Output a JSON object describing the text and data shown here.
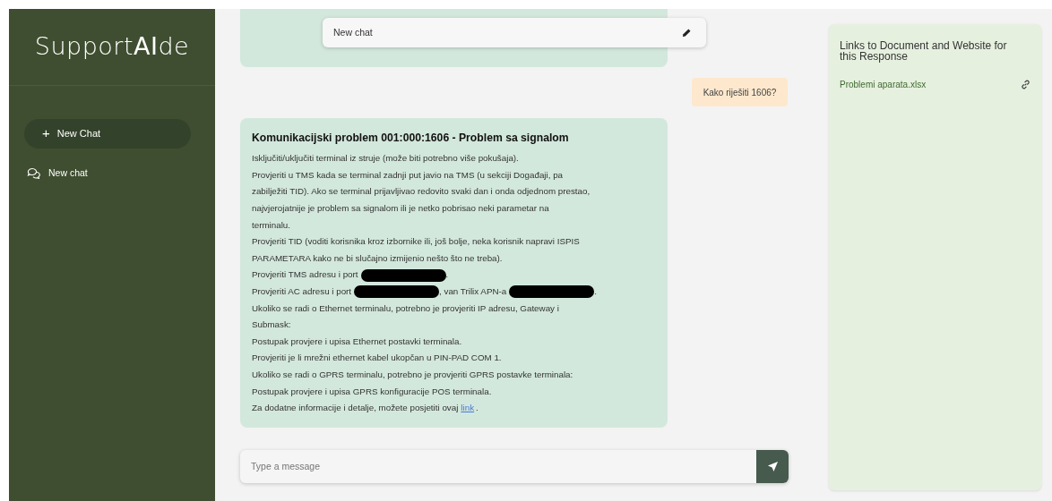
{
  "sidebar": {
    "logo": "Support**AI**de",
    "new_chat_button": {
      "icon": "+",
      "label": "New Chat"
    },
    "items": [
      {
        "label": "New chat",
        "selected": false
      }
    ]
  },
  "header": {
    "title": "New chat"
  },
  "messages": [
    {
      "kind": "cut"
    },
    {
      "kind": "user",
      "text": "Kako riješiti 1606?"
    },
    {
      "kind": "bot",
      "title": "Komunikacijski problem 001:000:1606 - Problem sa signalom",
      "lines": [
        [
          {
            "kind": "text",
            "text": "Isključiti/uključiti terminal iz struje (može biti potrebno više pokušaja)."
          }
        ],
        [
          {
            "kind": "text",
            "text": "Provjeriti u TMS kada se terminal zadnji put javio na TMS (u sekciji Događaji, pa"
          }
        ],
        [
          {
            "kind": "text",
            "text": "zabilježiti TID). Ako se terminal prijavljivao redovito svaki dan i onda odjednom prestao,"
          }
        ],
        [
          {
            "kind": "text",
            "text": "najvjerojatnije je problem sa signalom ili je netko pobrisao neki parametar na"
          }
        ],
        [
          {
            "kind": "text",
            "text": "terminalu."
          }
        ],
        [
          {
            "kind": "text",
            "text": "Provjeriti TID (voditi korisnika kroz izbornike ili, još bolje, neka korisnik napravi ISPIS"
          }
        ],
        [
          {
            "kind": "text",
            "text": "PARAMETARA kako ne bi slučajno izmijenio nešto što ne treba)."
          }
        ],
        [
          {
            "kind": "text",
            "text": "Provjeriti TMS adresu i port"
          },
          {
            "kind": "redacted"
          },
          {
            "kind": "text",
            "text": "."
          }
        ],
        [
          {
            "kind": "text",
            "text": "Provjeriti AC adresu i port"
          },
          {
            "kind": "redacted"
          },
          {
            "kind": "text",
            "text": ", van Trilix APN-a"
          },
          {
            "kind": "redacted"
          },
          {
            "kind": "text",
            "text": "."
          }
        ],
        [
          {
            "kind": "text",
            "text": "Ukoliko se radi o Ethernet terminalu, potrebno je provjeriti IP adresu, Gateway i"
          }
        ],
        [
          {
            "kind": "text",
            "text": "Submask:"
          }
        ],
        [
          {
            "kind": "text",
            "text": "Postupak provjere i upisa Ethernet postavki terminala."
          }
        ],
        [
          {
            "kind": "text",
            "text": "Provjeriti je li mrežni ethernet kabel ukopčan u PIN-PAD COM 1."
          }
        ],
        [
          {
            "kind": "text",
            "text": "Ukoliko se radi o GPRS terminalu, potrebno je provjeriti GPRS postavke terminala:"
          }
        ],
        [
          {
            "kind": "text",
            "text": "Postupak provjere i upisa GPRS konfiguracije POS terminala."
          }
        ],
        [
          {
            "kind": "text",
            "text": "Za dodatne informacije i detalje, možete posjetiti ovaj"
          },
          {
            "kind": "link",
            "text": "link"
          },
          {
            "kind": "text",
            "text": "."
          }
        ]
      ]
    }
  ],
  "composer": {
    "placeholder": "Type a message"
  },
  "links_panel": {
    "title": "Links to Document and Website for this Response",
    "links": [
      {
        "label": "Problemi aparata.xlsx"
      }
    ]
  }
}
